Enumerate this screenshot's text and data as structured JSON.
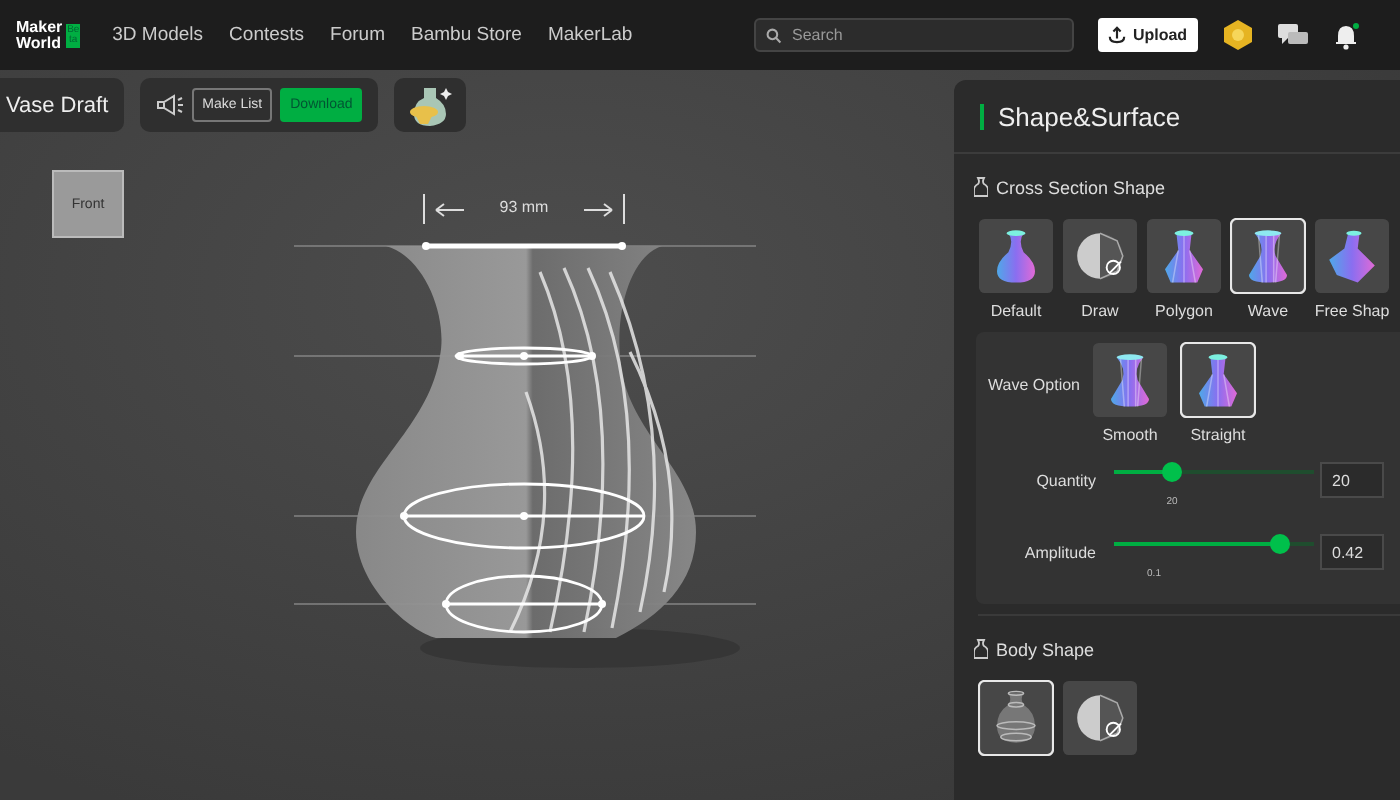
{
  "header": {
    "logo": {
      "line_1": "Maker",
      "line_2": "World",
      "badge": "Beta"
    },
    "nav": [
      "3D Models",
      "Contests",
      "Forum",
      "Bambu Store",
      "MakerLab"
    ],
    "search": {
      "placeholder": "Search"
    },
    "upload_button": "Upload"
  },
  "toolbar": {
    "title": "Vase Draft",
    "make_list_button": "Make List",
    "download_button": "Download"
  },
  "viewport": {
    "view_cube": "Front",
    "dimension": "93 mm"
  },
  "panel": {
    "title": "Shape&Surface",
    "cross_section": {
      "label": "Cross Section Shape",
      "options": [
        {
          "label": "Default",
          "kind": "default",
          "selected": false
        },
        {
          "label": "Draw",
          "kind": "draw",
          "selected": false
        },
        {
          "label": "Polygon",
          "kind": "polygon",
          "selected": false
        },
        {
          "label": "Wave",
          "kind": "wave",
          "selected": true
        },
        {
          "label": "Free Shap",
          "kind": "free",
          "selected": false
        }
      ]
    },
    "wave_option": {
      "label": "Wave Option",
      "options": [
        {
          "label": "Smooth",
          "kind": "wave",
          "selected": false
        },
        {
          "label": "Straight",
          "kind": "polygon",
          "selected": true
        }
      ]
    },
    "sliders": [
      {
        "label": "Quantity",
        "level": 0.29,
        "tick": "20",
        "value": "20"
      },
      {
        "label": "Amplitude",
        "level": 0.83,
        "tick": "0.1",
        "value": "0.42"
      }
    ],
    "body_shape": {
      "label": "Body Shape",
      "options": [
        {
          "kind": "rings",
          "selected": true
        },
        {
          "kind": "draw",
          "selected": false
        }
      ]
    }
  }
}
